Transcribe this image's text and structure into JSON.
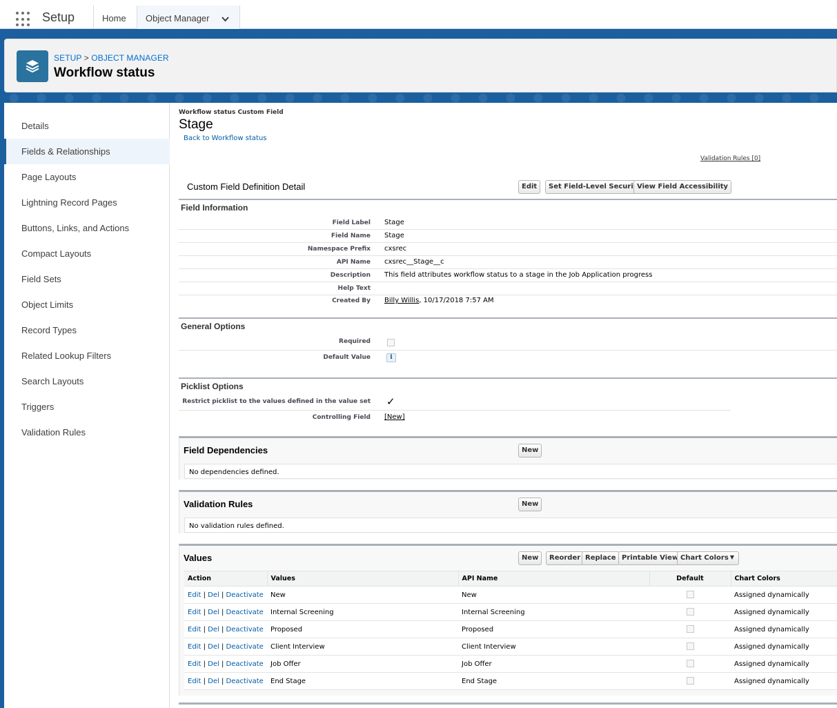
{
  "topbar": {
    "app_name": "Setup",
    "tabs": [
      {
        "label": "Home"
      },
      {
        "label": "Object Manager"
      }
    ]
  },
  "header": {
    "breadcrumb": [
      "SETUP",
      "OBJECT MANAGER"
    ],
    "title": "Workflow status",
    "icon": "stack-layers-icon"
  },
  "sidebar": {
    "items": [
      {
        "label": "Details"
      },
      {
        "label": "Fields & Relationships",
        "active": true
      },
      {
        "label": "Page Layouts"
      },
      {
        "label": "Lightning Record Pages"
      },
      {
        "label": "Buttons, Links, and Actions"
      },
      {
        "label": "Compact Layouts"
      },
      {
        "label": "Field Sets"
      },
      {
        "label": "Object Limits"
      },
      {
        "label": "Record Types"
      },
      {
        "label": "Related Lookup Filters"
      },
      {
        "label": "Search Layouts"
      },
      {
        "label": "Triggers"
      },
      {
        "label": "Validation Rules"
      }
    ]
  },
  "main": {
    "small_label": "Workflow status Custom Field",
    "field_title": "Stage",
    "back_link": "Back to Workflow status",
    "validation_rules_link": "Validation Rules [0]",
    "detail": {
      "title": "Custom Field Definition Detail",
      "buttons": [
        "Edit",
        "Set Field-Level Security",
        "View Field Accessibility"
      ]
    },
    "field_info": {
      "title": "Field Information",
      "rows": [
        {
          "label": "Field Label",
          "value": "Stage"
        },
        {
          "label": "Field Name",
          "value": "Stage"
        },
        {
          "label": "Namespace Prefix",
          "value": "cxsrec"
        },
        {
          "label": "API Name",
          "value": "cxsrec__Stage__c"
        },
        {
          "label": "Description",
          "value": "This field attributes workflow status to a stage in the Job Application progress"
        },
        {
          "label": "Help Text",
          "value": ""
        },
        {
          "label": "Created By",
          "value_link": "Billy Willis",
          "value": ", 10/17/2018 7:57 AM"
        }
      ]
    },
    "general_options": {
      "title": "General Options",
      "required_label": "Required",
      "default_label": "Default Value",
      "info_glyph": "i"
    },
    "picklist_options": {
      "title": "Picklist Options",
      "restrict_label": "Restrict picklist to the values defined in the value set",
      "restrict_checked": true,
      "check_glyph": "✓",
      "controlling_label": "Controlling Field",
      "controlling_link": "[New]"
    },
    "field_dependencies": {
      "title": "Field Dependencies",
      "button": "New",
      "empty": "No dependencies defined."
    },
    "validation_rules": {
      "title": "Validation Rules",
      "button": "New",
      "empty": "No validation rules defined."
    },
    "values": {
      "title": "Values",
      "buttons": [
        "New",
        "Reorder",
        "Replace",
        "Printable View"
      ],
      "chart_colors_button": "Chart Colors",
      "chart_colors_arrow": "▼",
      "columns": [
        "Action",
        "Values",
        "API Name",
        "Default",
        "Chart Colors"
      ],
      "action_links": [
        "Edit",
        "Del",
        "Deactivate"
      ],
      "action_sep": "|",
      "rows": [
        {
          "value": "New",
          "api": "New",
          "chart": "Assigned dynamically"
        },
        {
          "value": "Internal Screening",
          "api": "Internal Screening",
          "chart": "Assigned dynamically"
        },
        {
          "value": "Proposed",
          "api": "Proposed",
          "chart": "Assigned dynamically"
        },
        {
          "value": "Client Interview",
          "api": "Client Interview",
          "chart": "Assigned dynamically"
        },
        {
          "value": "Job Offer",
          "api": "Job Offer",
          "chart": "Assigned dynamically"
        },
        {
          "value": "End Stage",
          "api": "End Stage",
          "chart": "Assigned dynamically"
        }
      ]
    }
  }
}
